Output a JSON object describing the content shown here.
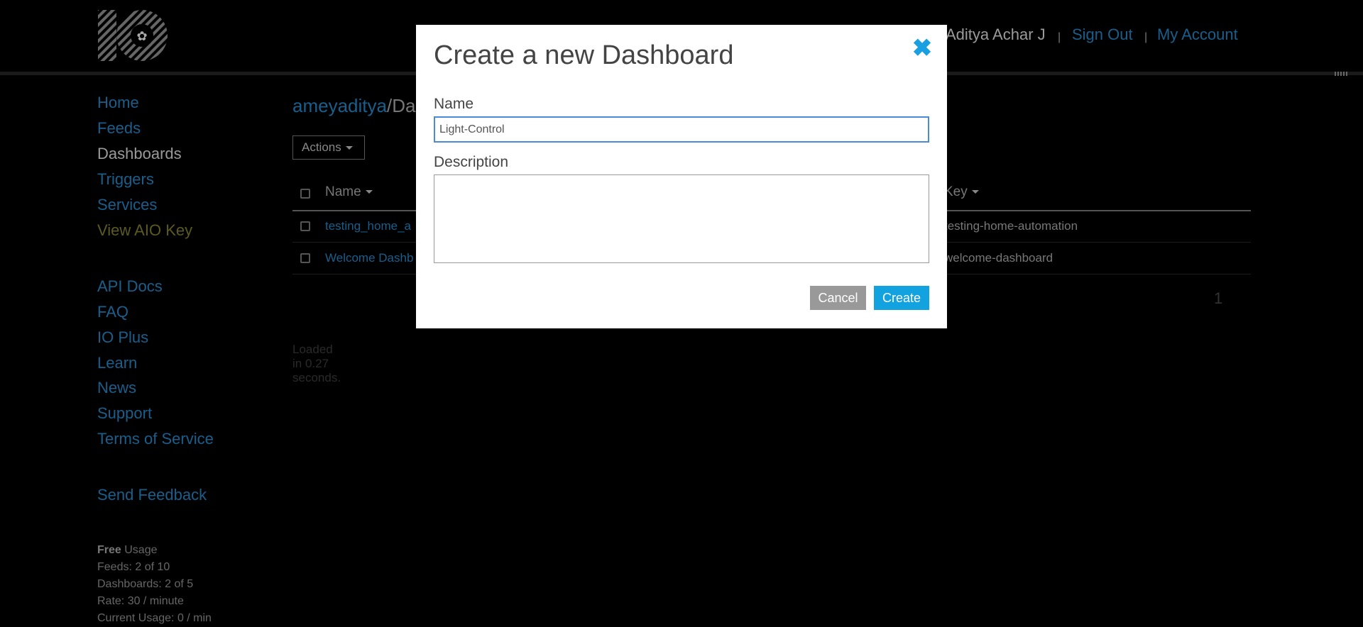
{
  "header": {
    "user_name": "Aditya Achar J",
    "separator": "|",
    "sign_out": "Sign Out",
    "my_account": "My Account"
  },
  "sidebar": {
    "items": [
      {
        "label": "Home"
      },
      {
        "label": "Feeds"
      },
      {
        "label": "Dashboards"
      },
      {
        "label": "Triggers"
      },
      {
        "label": "Services"
      },
      {
        "label": "View AIO Key"
      },
      {
        "label": "API Docs"
      },
      {
        "label": "FAQ"
      },
      {
        "label": "IO Plus"
      },
      {
        "label": "Learn"
      },
      {
        "label": "News"
      },
      {
        "label": "Support"
      },
      {
        "label": "Terms of Service"
      },
      {
        "label": "Send Feedback"
      }
    ],
    "usage": {
      "plan": "Free",
      "plan_suffix": " Usage",
      "feeds": "Feeds: 2 of 10",
      "dashboards": "Dashboards: 2 of 5",
      "rate": "Rate: 30 / minute",
      "current": "Current Usage: 0 / min"
    }
  },
  "main": {
    "breadcrumb_owner": "ameyaditya",
    "breadcrumb_slash": "/",
    "breadcrumb_rest": "Da",
    "actions_label": "Actions",
    "columns": {
      "name": "Name",
      "key": "Key"
    },
    "rows": [
      {
        "name": "testing_home_a",
        "key": "testing-home-automation"
      },
      {
        "name": "Welcome Dashb",
        "key": "welcome-dashboard"
      }
    ],
    "page_number": "1",
    "loaded_text": "Loaded in 0.27 seconds."
  },
  "modal": {
    "title": "Create a new Dashboard",
    "close_glyph": "✖",
    "name_label": "Name",
    "name_value": "Light-Control",
    "description_label": "Description",
    "description_value": "",
    "cancel_label": "Cancel",
    "create_label": "Create"
  },
  "colors": {
    "accent": "#12a2df",
    "link_dim": "#1a5f8c",
    "background": "#000000"
  }
}
